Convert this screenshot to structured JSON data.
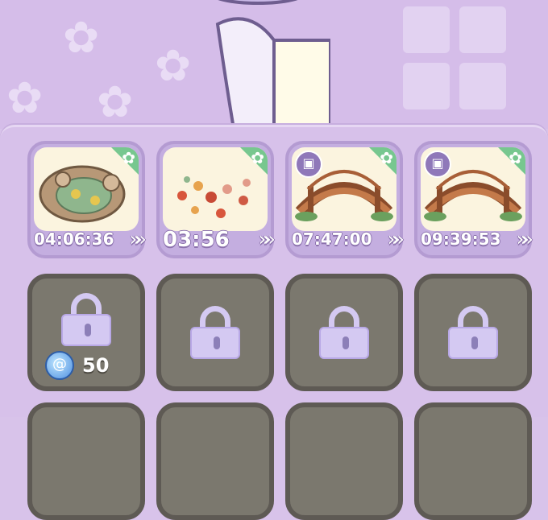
{
  "background": {
    "flower_glyph": "✿"
  },
  "slots": [
    {
      "name": "Lily Pond",
      "timer": "04:06:36",
      "icon": "pond",
      "has_pack": false
    },
    {
      "name": "Leaves",
      "timer": "03:56",
      "icon": "leaves",
      "has_pack": false
    },
    {
      "name": "Bridge",
      "timer": "07:47:00",
      "icon": "bridge",
      "has_pack": true
    },
    {
      "name": "Bridge",
      "timer": "09:39:53",
      "icon": "bridge",
      "has_pack": true
    }
  ],
  "locked": {
    "unlock_cost": "50"
  },
  "labels": {
    "ff": "»",
    "gear": "✿",
    "pack": "▣"
  },
  "colors": {
    "ribbon": "#77c78f",
    "lock_slot": "#7b786e",
    "panel": "#d7c1ea"
  }
}
